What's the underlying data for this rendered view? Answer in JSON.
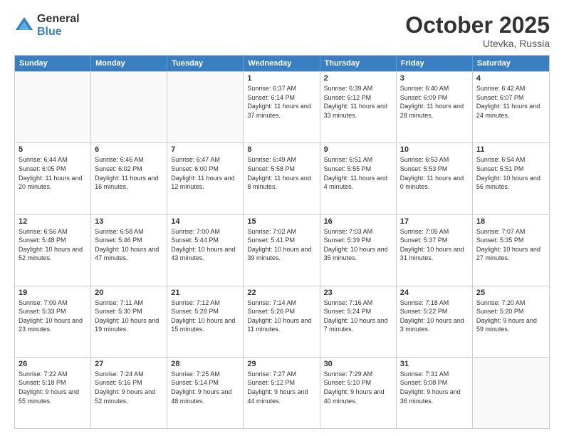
{
  "logo": {
    "general": "General",
    "blue": "Blue"
  },
  "title": "October 2025",
  "location": "Utevka, Russia",
  "days_of_week": [
    "Sunday",
    "Monday",
    "Tuesday",
    "Wednesday",
    "Thursday",
    "Friday",
    "Saturday"
  ],
  "weeks": [
    [
      {
        "day": "",
        "sunrise": "",
        "sunset": "",
        "daylight": "",
        "empty": true
      },
      {
        "day": "",
        "sunrise": "",
        "sunset": "",
        "daylight": "",
        "empty": true
      },
      {
        "day": "",
        "sunrise": "",
        "sunset": "",
        "daylight": "",
        "empty": true
      },
      {
        "day": "1",
        "sunrise": "Sunrise: 6:37 AM",
        "sunset": "Sunset: 6:14 PM",
        "daylight": "Daylight: 11 hours and 37 minutes."
      },
      {
        "day": "2",
        "sunrise": "Sunrise: 6:39 AM",
        "sunset": "Sunset: 6:12 PM",
        "daylight": "Daylight: 11 hours and 33 minutes."
      },
      {
        "day": "3",
        "sunrise": "Sunrise: 6:40 AM",
        "sunset": "Sunset: 6:09 PM",
        "daylight": "Daylight: 11 hours and 28 minutes."
      },
      {
        "day": "4",
        "sunrise": "Sunrise: 6:42 AM",
        "sunset": "Sunset: 6:07 PM",
        "daylight": "Daylight: 11 hours and 24 minutes."
      }
    ],
    [
      {
        "day": "5",
        "sunrise": "Sunrise: 6:44 AM",
        "sunset": "Sunset: 6:05 PM",
        "daylight": "Daylight: 11 hours and 20 minutes."
      },
      {
        "day": "6",
        "sunrise": "Sunrise: 6:46 AM",
        "sunset": "Sunset: 6:02 PM",
        "daylight": "Daylight: 11 hours and 16 minutes."
      },
      {
        "day": "7",
        "sunrise": "Sunrise: 6:47 AM",
        "sunset": "Sunset: 6:00 PM",
        "daylight": "Daylight: 11 hours and 12 minutes."
      },
      {
        "day": "8",
        "sunrise": "Sunrise: 6:49 AM",
        "sunset": "Sunset: 5:58 PM",
        "daylight": "Daylight: 11 hours and 8 minutes."
      },
      {
        "day": "9",
        "sunrise": "Sunrise: 6:51 AM",
        "sunset": "Sunset: 5:55 PM",
        "daylight": "Daylight: 11 hours and 4 minutes."
      },
      {
        "day": "10",
        "sunrise": "Sunrise: 6:53 AM",
        "sunset": "Sunset: 5:53 PM",
        "daylight": "Daylight: 11 hours and 0 minutes."
      },
      {
        "day": "11",
        "sunrise": "Sunrise: 6:54 AM",
        "sunset": "Sunset: 5:51 PM",
        "daylight": "Daylight: 10 hours and 56 minutes."
      }
    ],
    [
      {
        "day": "12",
        "sunrise": "Sunrise: 6:56 AM",
        "sunset": "Sunset: 5:48 PM",
        "daylight": "Daylight: 10 hours and 52 minutes."
      },
      {
        "day": "13",
        "sunrise": "Sunrise: 6:58 AM",
        "sunset": "Sunset: 5:46 PM",
        "daylight": "Daylight: 10 hours and 47 minutes."
      },
      {
        "day": "14",
        "sunrise": "Sunrise: 7:00 AM",
        "sunset": "Sunset: 5:44 PM",
        "daylight": "Daylight: 10 hours and 43 minutes."
      },
      {
        "day": "15",
        "sunrise": "Sunrise: 7:02 AM",
        "sunset": "Sunset: 5:41 PM",
        "daylight": "Daylight: 10 hours and 39 minutes."
      },
      {
        "day": "16",
        "sunrise": "Sunrise: 7:03 AM",
        "sunset": "Sunset: 5:39 PM",
        "daylight": "Daylight: 10 hours and 35 minutes."
      },
      {
        "day": "17",
        "sunrise": "Sunrise: 7:05 AM",
        "sunset": "Sunset: 5:37 PM",
        "daylight": "Daylight: 10 hours and 31 minutes."
      },
      {
        "day": "18",
        "sunrise": "Sunrise: 7:07 AM",
        "sunset": "Sunset: 5:35 PM",
        "daylight": "Daylight: 10 hours and 27 minutes."
      }
    ],
    [
      {
        "day": "19",
        "sunrise": "Sunrise: 7:09 AM",
        "sunset": "Sunset: 5:33 PM",
        "daylight": "Daylight: 10 hours and 23 minutes."
      },
      {
        "day": "20",
        "sunrise": "Sunrise: 7:11 AM",
        "sunset": "Sunset: 5:30 PM",
        "daylight": "Daylight: 10 hours and 19 minutes."
      },
      {
        "day": "21",
        "sunrise": "Sunrise: 7:12 AM",
        "sunset": "Sunset: 5:28 PM",
        "daylight": "Daylight: 10 hours and 15 minutes."
      },
      {
        "day": "22",
        "sunrise": "Sunrise: 7:14 AM",
        "sunset": "Sunset: 5:26 PM",
        "daylight": "Daylight: 10 hours and 11 minutes."
      },
      {
        "day": "23",
        "sunrise": "Sunrise: 7:16 AM",
        "sunset": "Sunset: 5:24 PM",
        "daylight": "Daylight: 10 hours and 7 minutes."
      },
      {
        "day": "24",
        "sunrise": "Sunrise: 7:18 AM",
        "sunset": "Sunset: 5:22 PM",
        "daylight": "Daylight: 10 hours and 3 minutes."
      },
      {
        "day": "25",
        "sunrise": "Sunrise: 7:20 AM",
        "sunset": "Sunset: 5:20 PM",
        "daylight": "Daylight: 9 hours and 59 minutes."
      }
    ],
    [
      {
        "day": "26",
        "sunrise": "Sunrise: 7:22 AM",
        "sunset": "Sunset: 5:18 PM",
        "daylight": "Daylight: 9 hours and 55 minutes."
      },
      {
        "day": "27",
        "sunrise": "Sunrise: 7:24 AM",
        "sunset": "Sunset: 5:16 PM",
        "daylight": "Daylight: 9 hours and 52 minutes."
      },
      {
        "day": "28",
        "sunrise": "Sunrise: 7:25 AM",
        "sunset": "Sunset: 5:14 PM",
        "daylight": "Daylight: 9 hours and 48 minutes."
      },
      {
        "day": "29",
        "sunrise": "Sunrise: 7:27 AM",
        "sunset": "Sunset: 5:12 PM",
        "daylight": "Daylight: 9 hours and 44 minutes."
      },
      {
        "day": "30",
        "sunrise": "Sunrise: 7:29 AM",
        "sunset": "Sunset: 5:10 PM",
        "daylight": "Daylight: 9 hours and 40 minutes."
      },
      {
        "day": "31",
        "sunrise": "Sunrise: 7:31 AM",
        "sunset": "Sunset: 5:08 PM",
        "daylight": "Daylight: 9 hours and 36 minutes."
      },
      {
        "day": "",
        "sunrise": "",
        "sunset": "",
        "daylight": "",
        "empty": true
      }
    ]
  ]
}
